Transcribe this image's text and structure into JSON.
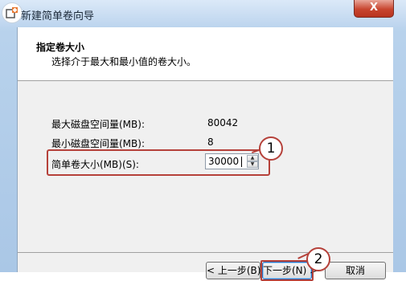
{
  "window": {
    "title": "新建简单卷向导",
    "close_label": "X"
  },
  "header": {
    "title": "指定卷大小",
    "subtitle": "选择介于最大和最小值的卷大小。"
  },
  "fields": {
    "max_label": "最大磁盘空间量(MB):",
    "max_value": "80042",
    "min_label": "最小磁盘空间量(MB):",
    "min_value": "8",
    "size_label": "简单卷大小(MB)(S):",
    "size_value": "30000"
  },
  "buttons": {
    "back": "< 上一步(B)",
    "next": "下一步(N) >",
    "cancel": "取消"
  },
  "annotations": {
    "marker_1": "1",
    "marker_2": "2"
  },
  "colors": {
    "annotation_red": "#b5413a",
    "close_red": "#c8452f"
  },
  "icons": {
    "app": "disk-add-icon",
    "spin_up": "chevron-up-icon",
    "spin_down": "chevron-down-icon"
  }
}
